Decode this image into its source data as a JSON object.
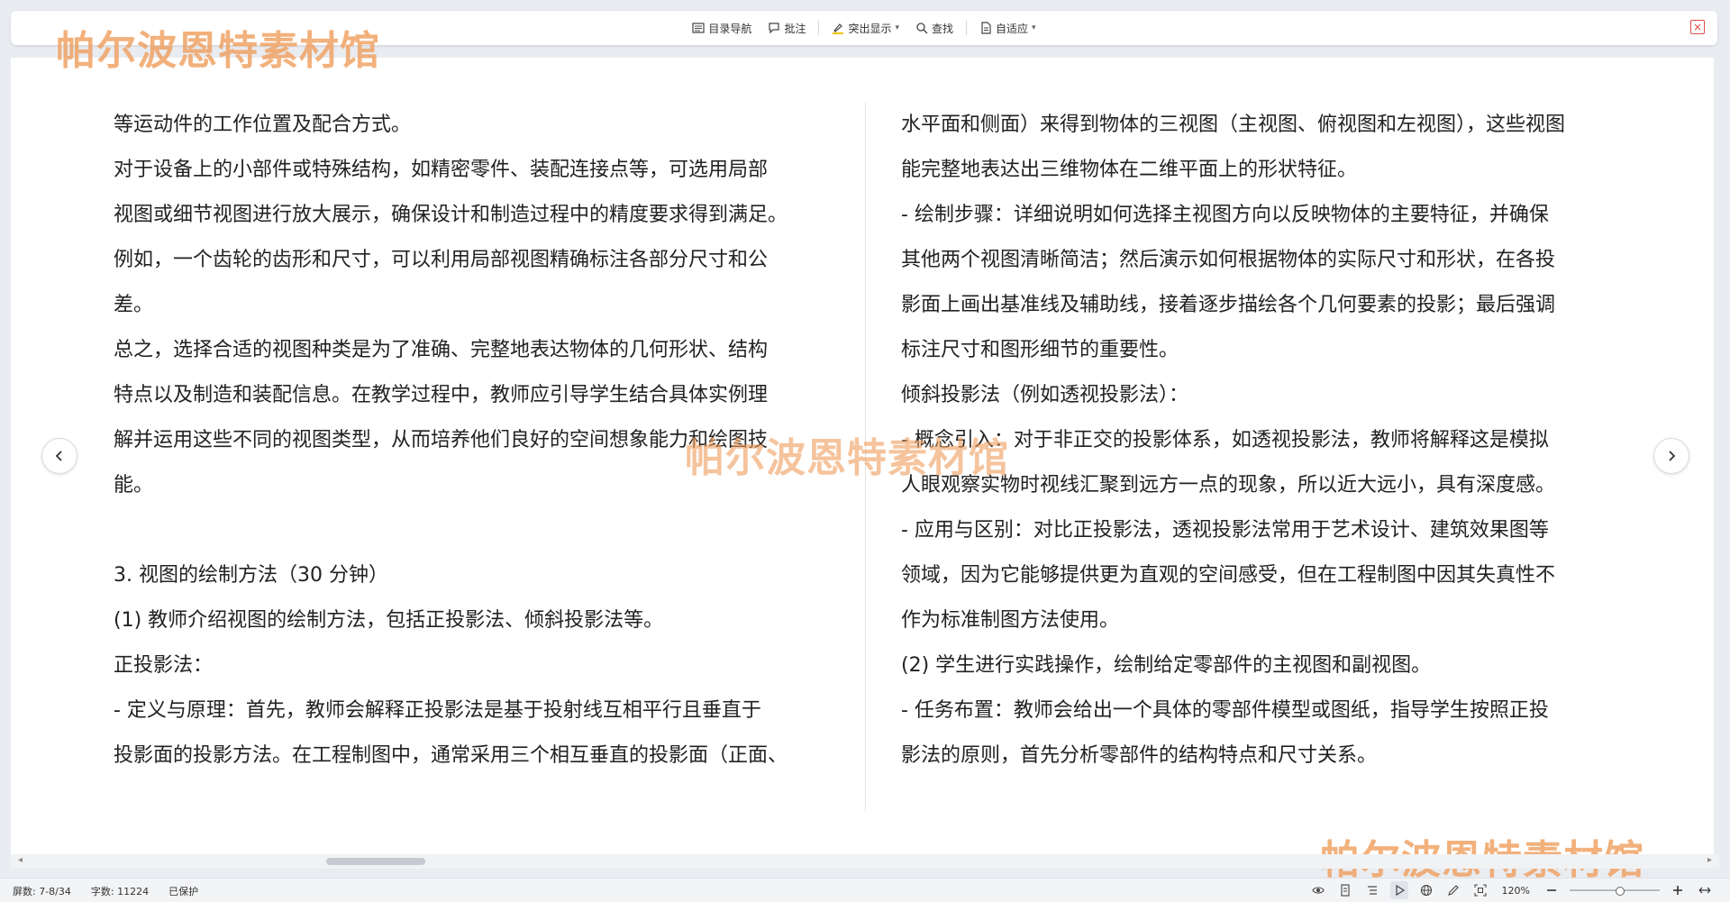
{
  "toolbar": {
    "catalog_nav": "目录导航",
    "comments": "批注",
    "highlight": "突出显示",
    "find": "查找",
    "fit": "自适应"
  },
  "watermark": "帕尔波恩特素材馆",
  "document": {
    "left_column": [
      "等运动件的工作位置及配合方式。",
      "对于设备上的小部件或特殊结构，如精密零件、装配连接点等，可选用局部",
      "视图或细节视图进行放大展示，确保设计和制造过程中的精度要求得到满足。",
      "例如，一个齿轮的齿形和尺寸，可以利用局部视图精确标注各部分尺寸和公",
      "差。",
      "总之，选择合适的视图种类是为了准确、完整地表达物体的几何形状、结构",
      "特点以及制造和装配信息。在教学过程中，教师应引导学生结合具体实例理",
      "解并运用这些不同的视图类型，从而培养他们良好的空间想象能力和绘图技",
      "能。",
      "",
      "3. 视图的绘制方法（30 分钟）",
      "(1) 教师介绍视图的绘制方法，包括正投影法、倾斜投影法等。",
      "正投影法：",
      "- 定义与原理：首先，教师会解释正投影法是基于投射线互相平行且垂直于",
      "投影面的投影方法。在工程制图中，通常采用三个相互垂直的投影面（正面、"
    ],
    "right_column": [
      "水平面和侧面）来得到物体的三视图（主视图、俯视图和左视图），这些视图",
      "能完整地表达出三维物体在二维平面上的形状特征。",
      "- 绘制步骤：详细说明如何选择主视图方向以反映物体的主要特征，并确保",
      "其他两个视图清晰简洁；然后演示如何根据物体的实际尺寸和形状，在各投",
      "影面上画出基准线及辅助线，接着逐步描绘各个几何要素的投影；最后强调",
      "标注尺寸和图形细节的重要性。",
      "倾斜投影法（例如透视投影法）：",
      "- 概念引入：对于非正交的投影体系，如透视投影法，教师将解释这是模拟",
      "人眼观察实物时视线汇聚到远方一点的现象，所以近大远小，具有深度感。",
      "- 应用与区别：对比正投影法，透视投影法常用于艺术设计、建筑效果图等",
      "领域，因为它能够提供更为直观的空间感受，但在工程制图中因其失真性不",
      "作为标准制图方法使用。",
      "(2) 学生进行实践操作，绘制给定零部件的主视图和副视图。",
      "- 任务布置：教师会给出一个具体的零部件模型或图纸，指导学生按照正投",
      "影法的原则，首先分析零部件的结构特点和尺寸关系。"
    ]
  },
  "status": {
    "pages": "屏数: 7-8/34",
    "word_count": "字数: 11224",
    "protected": "已保护",
    "zoom": "120%",
    "zoom_level": 0.55
  },
  "colors": {
    "accent_red": "#e04b4b",
    "watermark": "#f0a060"
  }
}
